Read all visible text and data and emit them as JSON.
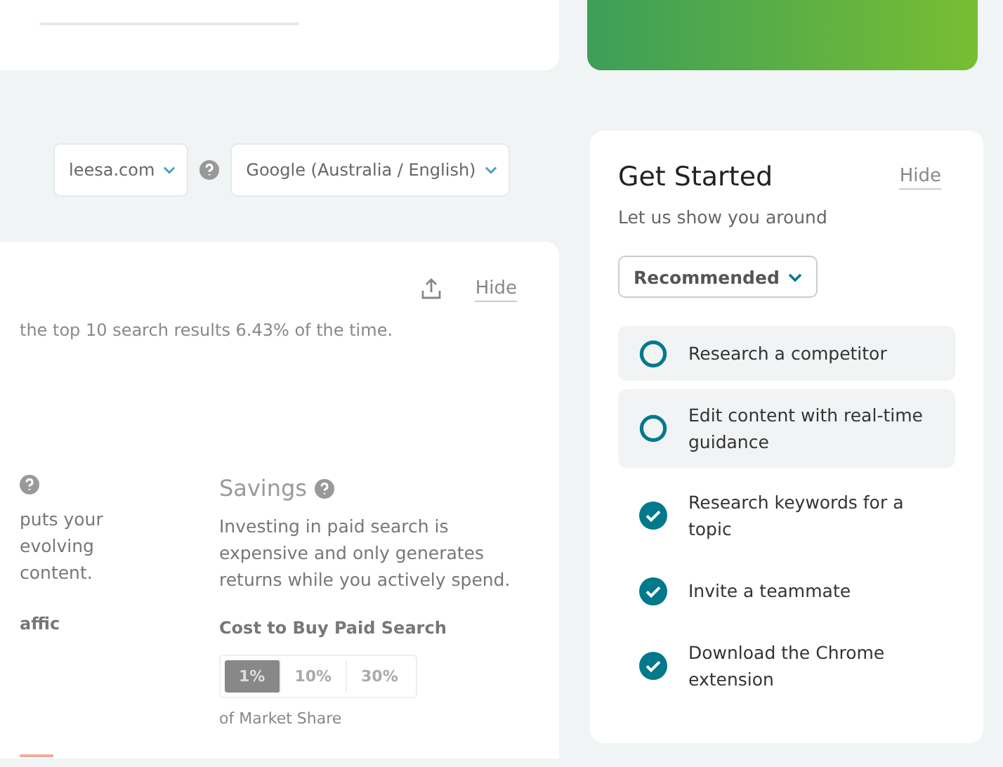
{
  "filters": {
    "domain": "leesa.com",
    "engine": "Google (Australia / English)"
  },
  "report": {
    "hide": "Hide",
    "summary": "the top 10 search results 6.43% of the time.",
    "left_column": {
      "lines": [
        "puts your",
        "evolving",
        "content."
      ],
      "subheading": "affic"
    },
    "savings": {
      "title": "Savings",
      "text": "Investing in paid search is expensive and only generates returns while you actively spend.",
      "subheading": "Cost to Buy Paid Search",
      "options": [
        {
          "label": "1%",
          "selected": true
        },
        {
          "label": "10%",
          "selected": false
        },
        {
          "label": "30%",
          "selected": false
        }
      ],
      "caption": "of Market Share"
    }
  },
  "get_started": {
    "title": "Get Started",
    "hide": "Hide",
    "subtitle": "Let us show you around",
    "filter": "Recommended",
    "tasks": [
      {
        "label": "Research a competitor",
        "done": false
      },
      {
        "label": "Edit content with real-time guidance",
        "done": false
      },
      {
        "label": "Research keywords for a topic",
        "done": true
      },
      {
        "label": "Invite a teammate",
        "done": true
      },
      {
        "label": "Download the Chrome extension",
        "done": true
      }
    ]
  }
}
